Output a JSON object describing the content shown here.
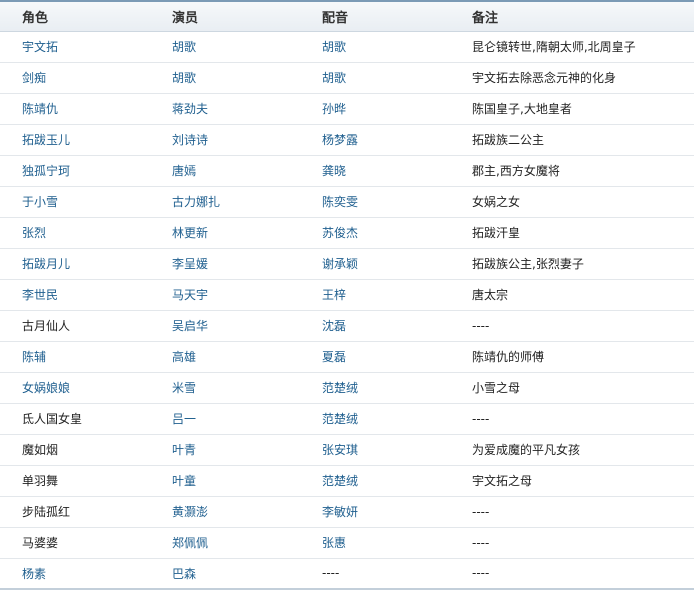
{
  "headers": [
    "角色",
    "演员",
    "配音",
    "备注"
  ],
  "rows": [
    [
      "宇文拓",
      "胡歌",
      "胡歌",
      "昆仑镜转世,隋朝太师,北周皇子"
    ],
    [
      "剑痴",
      "胡歌",
      "胡歌",
      "宇文拓去除恶念元神的化身"
    ],
    [
      "陈靖仇",
      "蒋劲夫",
      "孙晔",
      "陈国皇子,大地皇者"
    ],
    [
      "拓跋玉儿",
      "刘诗诗",
      "杨梦露",
      "拓跋族二公主"
    ],
    [
      "独孤宁珂",
      "唐嫣",
      "龚晓",
      "郡主,西方女魔将"
    ],
    [
      "于小雪",
      "古力娜扎",
      "陈奕雯",
      "女娲之女"
    ],
    [
      "张烈",
      "林更新",
      "苏俊杰",
      "拓跋汗皇"
    ],
    [
      "拓跋月儿",
      "李呈媛",
      "谢承颖",
      "拓跋族公主,张烈妻子"
    ],
    [
      "李世民",
      "马天宇",
      "王梓",
      "唐太宗"
    ],
    [
      "古月仙人",
      "吴启华",
      "沈磊",
      "----"
    ],
    [
      "陈辅",
      "高雄",
      "夏磊",
      "陈靖仇的师傅"
    ],
    [
      "女娲娘娘",
      "米雪",
      "范楚绒",
      "小雪之母"
    ],
    [
      "氐人国女皇",
      "吕一",
      "范楚绒",
      "----"
    ],
    [
      "魔如烟",
      "叶青",
      "张安琪",
      "为爱成魔的平凡女孩"
    ],
    [
      "单羽舞",
      "叶童",
      "范楚绒",
      "宇文拓之母"
    ],
    [
      "步陆孤红",
      "黄灏澎",
      "李敏妍",
      "----"
    ],
    [
      "马婆婆",
      "郑佩佩",
      "张惠",
      "----"
    ],
    [
      "杨素",
      "巴森",
      "----",
      "----"
    ]
  ],
  "links": [
    [
      true,
      true,
      true,
      false
    ],
    [
      true,
      true,
      true,
      false
    ],
    [
      true,
      true,
      true,
      false
    ],
    [
      true,
      true,
      true,
      false
    ],
    [
      true,
      true,
      true,
      false
    ],
    [
      true,
      true,
      true,
      false
    ],
    [
      true,
      true,
      true,
      false
    ],
    [
      true,
      true,
      true,
      false
    ],
    [
      true,
      true,
      true,
      false
    ],
    [
      false,
      true,
      true,
      false
    ],
    [
      true,
      true,
      true,
      false
    ],
    [
      true,
      true,
      true,
      false
    ],
    [
      false,
      true,
      true,
      false
    ],
    [
      false,
      true,
      true,
      false
    ],
    [
      false,
      true,
      true,
      false
    ],
    [
      false,
      true,
      true,
      false
    ],
    [
      false,
      true,
      true,
      false
    ],
    [
      true,
      true,
      false,
      false
    ]
  ],
  "colors": {
    "link": "#1f5f8f",
    "text": "#222222",
    "header_text": "#333333"
  }
}
